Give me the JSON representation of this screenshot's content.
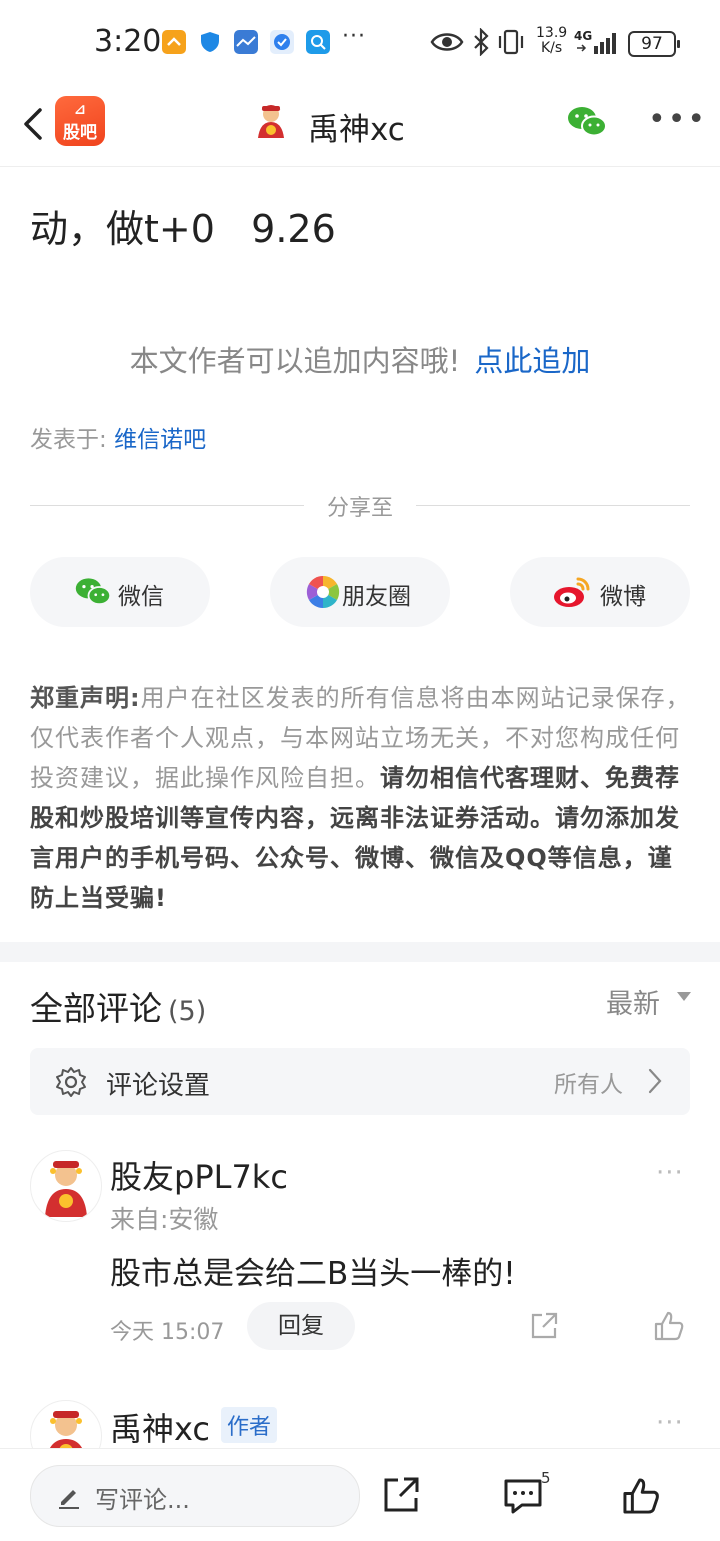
{
  "status_bar": {
    "time": "3:20",
    "more_indicator": "···",
    "network_speed_top": "13.9",
    "network_speed_bottom": "K/s",
    "signal_type": "4G",
    "battery": "97",
    "icons": [
      "app-notify-icon",
      "shield-icon",
      "map-icon",
      "vpn-icon",
      "search-app-icon",
      "eye-icon",
      "bluetooth-icon",
      "vibrate-icon",
      "signal-icon"
    ]
  },
  "nav": {
    "app_badge_top": "⊿",
    "app_badge_text": "股吧",
    "title": "禹神xc"
  },
  "article": {
    "last_line": "动，做t+0   9.26",
    "append_text": "本文作者可以追加内容哦!",
    "append_link": "点此追加",
    "posted_in_label": "发表于:",
    "posted_in_bar": "维信诺吧",
    "share_label": "分享至",
    "share_buttons": [
      {
        "label": "微信",
        "icon": "wechat-icon"
      },
      {
        "label": "朋友圈",
        "icon": "moments-icon"
      },
      {
        "label": "微博",
        "icon": "weibo-icon"
      }
    ],
    "notice_title": "郑重声明",
    "notice_colon": ":",
    "notice_normal": "用户在社区发表的所有信息将由本网站记录保存，仅代表作者个人观点，与本网站立场无关，不对您构成任何投资建议，据此操作风险自担。",
    "notice_strong": "请勿相信代客理财、免费荐股和炒股培训等宣传内容，远离非法证券活动。请勿添加发言用户的手机号码、公众号、微博、微信及QQ等信息，谨防上当受骗!"
  },
  "comments": {
    "title": "全部评论",
    "count": "(5)",
    "sort_label": "最新",
    "settings_label": "评论设置",
    "settings_value": "所有人",
    "items": [
      {
        "username": "股友pPL7kc",
        "location": "来自:安徽",
        "text": "股市总是会给二B当头一棒的!",
        "time": "今天 15:07",
        "reply_label": "回复",
        "more": "···"
      },
      {
        "username": "禹神xc",
        "author_badge": "作者",
        "more": "···"
      }
    ]
  },
  "bottom_bar": {
    "placeholder": "写评论...",
    "comment_count": "5"
  }
}
